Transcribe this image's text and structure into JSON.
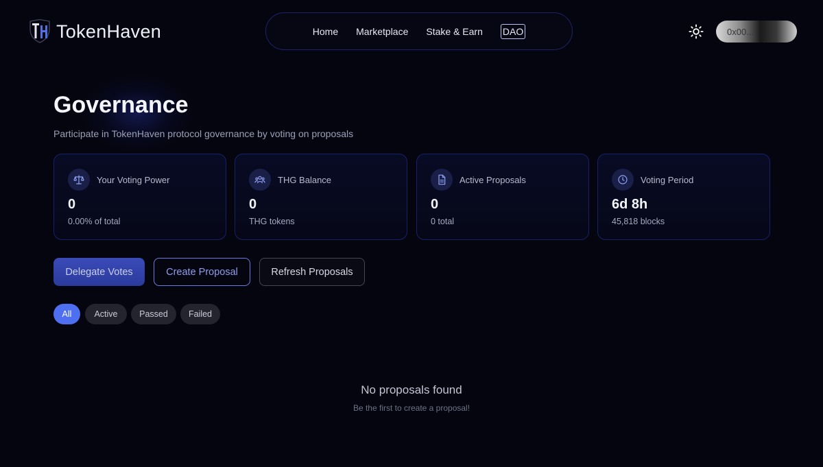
{
  "brand": {
    "name": "TokenHaven"
  },
  "nav": {
    "items": [
      {
        "label": "Home",
        "active": false
      },
      {
        "label": "Marketplace",
        "active": false
      },
      {
        "label": "Stake & Earn",
        "active": false
      },
      {
        "label": "DAO",
        "active": true
      }
    ]
  },
  "header": {
    "theme_icon": "sun-icon",
    "wallet_label": "0x00..."
  },
  "page": {
    "title": "Governance",
    "subtitle": "Participate in TokenHaven protocol governance by voting on proposals"
  },
  "stats": [
    {
      "icon": "scale-icon",
      "label": "Your Voting Power",
      "value": "0",
      "note": "0.00% of total"
    },
    {
      "icon": "users-icon",
      "label": "THG Balance",
      "value": "0",
      "note": "THG tokens"
    },
    {
      "icon": "document-icon",
      "label": "Active Proposals",
      "value": "0",
      "note": "0 total"
    },
    {
      "icon": "clock-icon",
      "label": "Voting Period",
      "value": "6d 8h",
      "note": "45,818 blocks"
    }
  ],
  "actions": {
    "delegate": "Delegate Votes",
    "create": "Create Proposal",
    "refresh": "Refresh Proposals"
  },
  "filters": [
    {
      "label": "All",
      "active": true
    },
    {
      "label": "Active",
      "active": false
    },
    {
      "label": "Passed",
      "active": false
    },
    {
      "label": "Failed",
      "active": false
    }
  ],
  "empty": {
    "title": "No proposals found",
    "subtitle": "Be the first to create a proposal!"
  },
  "colors": {
    "background": "#05050f",
    "accent": "#4d6ff0",
    "card_border": "#19206a"
  }
}
